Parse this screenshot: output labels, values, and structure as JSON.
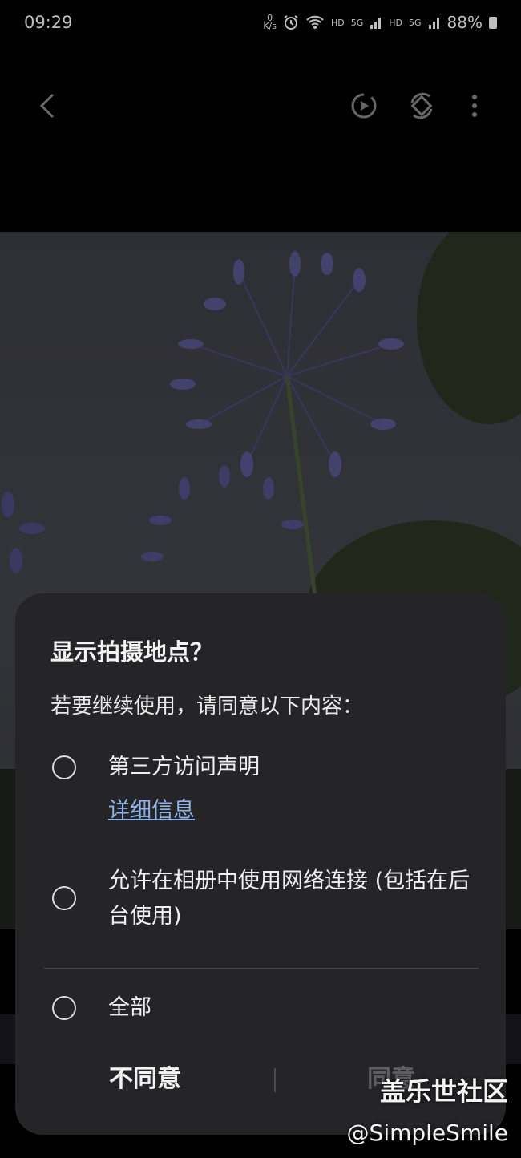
{
  "status_bar": {
    "time": "09:29",
    "net_speed_value": "0",
    "net_speed_unit": "K/s",
    "hd1": "HD",
    "sig1": "5G",
    "hd2": "HD",
    "sig2": "5G",
    "battery": "88%",
    "icons": [
      "alarm-icon",
      "wifi-icon",
      "signal-icon",
      "battery-icon"
    ]
  },
  "app_bar": {
    "icons": [
      "back-icon",
      "motion-photo-icon",
      "rotate-icon",
      "more-options-icon"
    ]
  },
  "dialog": {
    "title": "显示拍摄地点？",
    "description": "若要继续使用，请同意以下内容：",
    "options": [
      {
        "label": "第三方访问声明",
        "link": "详细信息",
        "checked": false
      },
      {
        "label": "允许在相册中使用网络连接 (包括在后台使用)",
        "checked": false
      },
      {
        "label": "全部",
        "checked": false
      }
    ],
    "buttons": {
      "disagree": "不同意",
      "agree": "同意"
    }
  },
  "watermark": {
    "site": "盖乐世社区",
    "user": "@SimpleSmile"
  },
  "colors": {
    "dialog_bg": "#252528",
    "link": "#8fb4ea",
    "disabled": "#5e5e62"
  }
}
